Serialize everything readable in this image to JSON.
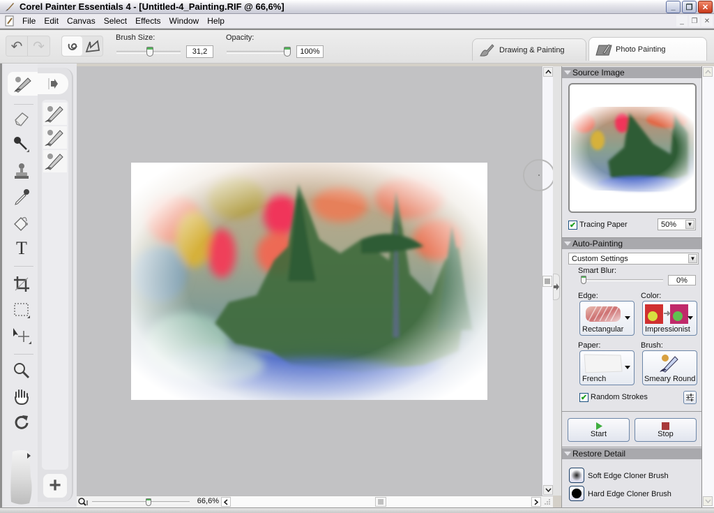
{
  "window": {
    "title": "Corel Painter Essentials 4 - [Untitled-4_Painting.RIF @ 66,6%]",
    "buttons": {
      "minimize": "_",
      "restore": "❐",
      "close": "✕"
    }
  },
  "menubar": {
    "items": [
      "File",
      "Edit",
      "Canvas",
      "Select",
      "Effects",
      "Window",
      "Help"
    ],
    "mdi_buttons": {
      "minimize": "_",
      "restore": "❐",
      "close": "✕"
    }
  },
  "toolbar": {
    "undo_icon": "↶",
    "redo_icon": "↷",
    "freehand_icon": "ↄ",
    "straight_lines_icon": "⊿",
    "brush_size_label": "Brush Size:",
    "brush_size_value": "31,2",
    "brush_size_fraction": 0.52,
    "opacity_label": "Opacity:",
    "opacity_value": "100%",
    "opacity_fraction": 1.0
  },
  "workspace_tabs": [
    {
      "label": "Drawing & Painting",
      "active": false
    },
    {
      "label": "Photo Painting",
      "active": true
    }
  ],
  "tools": [
    "brush",
    "eraser",
    "dropper-magic-wand",
    "stamp-cloner",
    "eyedropper",
    "paint-bucket",
    "text",
    "crop",
    "rectangular-selection",
    "transform",
    "magnifier",
    "grabber-hand",
    "rotate-page",
    "paper-texture"
  ],
  "tools_labels": {
    "text": "T",
    "add": "+"
  },
  "canvas": {
    "zoom_value": "66,6%",
    "zoom_fraction": 0.58
  },
  "source_image": {
    "title": "Source Image",
    "tracing_paper_label": "Tracing Paper",
    "tracing_paper_checked": true,
    "tracing_opacity": "50%"
  },
  "auto_painting": {
    "title": "Auto-Painting",
    "preset": "Custom Settings",
    "smart_blur_label": "Smart Blur:",
    "smart_blur_value": "0%",
    "edge_label": "Edge:",
    "edge_value": "Rectangular",
    "color_label": "Color:",
    "color_value": "Impressionist",
    "paper_label": "Paper:",
    "paper_value": "French",
    "brush_label": "Brush:",
    "brush_value": "Smeary Round",
    "random_strokes_label": "Random Strokes",
    "random_strokes_checked": true,
    "start_label": "Start",
    "stop_label": "Stop"
  },
  "restore_detail": {
    "title": "Restore Detail",
    "soft_label": "Soft Edge Cloner Brush",
    "hard_label": "Hard Edge Cloner Brush"
  },
  "colors": {
    "start_green": "#3fae3f",
    "stop_red": "#a83a3a",
    "check_green": "#21a121",
    "panel_header": "#a9a9ad"
  }
}
